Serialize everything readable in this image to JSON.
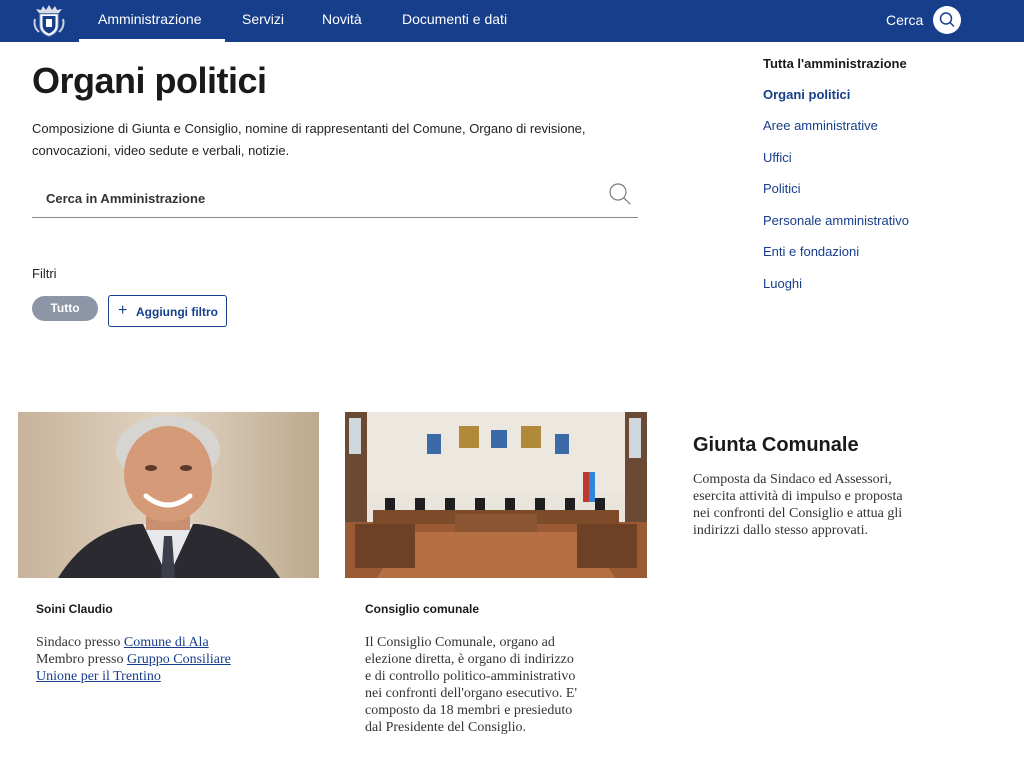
{
  "nav": {
    "items": [
      "Amministrazione",
      "Servizi",
      "Novità",
      "Documenti e dati"
    ],
    "search_label": "Cerca",
    "colors": {
      "bar": "#173e8a",
      "text": "#ffffff"
    }
  },
  "page": {
    "title": "Organi politici",
    "description_line1": "Composizione di Giunta e Consiglio, nomine di rappresentanti del Comune, Organo di revisione,",
    "description_line2": "convocazioni, video sedute e verbali, notizie.",
    "search_placeholder": "Cerca in Amministrazione"
  },
  "filters": {
    "label": "Filtri",
    "active_chip": "Tutto",
    "add_button": "Aggiungi filtro"
  },
  "sidebar": {
    "heading": "Tutta l'amministrazione",
    "items": [
      "Organi politici",
      "Aree amministrative",
      "Uffici",
      "Politici",
      "Personale amministrativo",
      "Enti e fondazioni",
      "Luoghi"
    ]
  },
  "cards": [
    {
      "title": "Soini Claudio",
      "line1_prefix": "Sindaco presso ",
      "line1_link": "Comune di Ala",
      "line2_prefix": "Membro presso ",
      "line2_link_a": "Gruppo Consiliare",
      "line2_link_b": "Unione per il Trentino"
    },
    {
      "title": "Consiglio comunale",
      "text_lines": [
        "Il Consiglio Comunale, organo ad",
        "elezione diretta, è organo di indirizzo",
        "e di controllo politico-amministrativo",
        "nei confronti dell'organo esecutivo. E'",
        "composto da 18 membri e presieduto",
        "dal Presidente del Consiglio."
      ]
    }
  ],
  "giunta": {
    "title": "Giunta Comunale",
    "text_lines": [
      "Composta da Sindaco ed Assessori,",
      "esercita attività di impulso e proposta",
      "nei confronti del Consiglio e attua gli",
      "indirizzi dallo stesso approvati."
    ]
  },
  "icons": {
    "logo": "municipal-crest-icon",
    "search": "search-icon",
    "add": "plus-icon"
  }
}
